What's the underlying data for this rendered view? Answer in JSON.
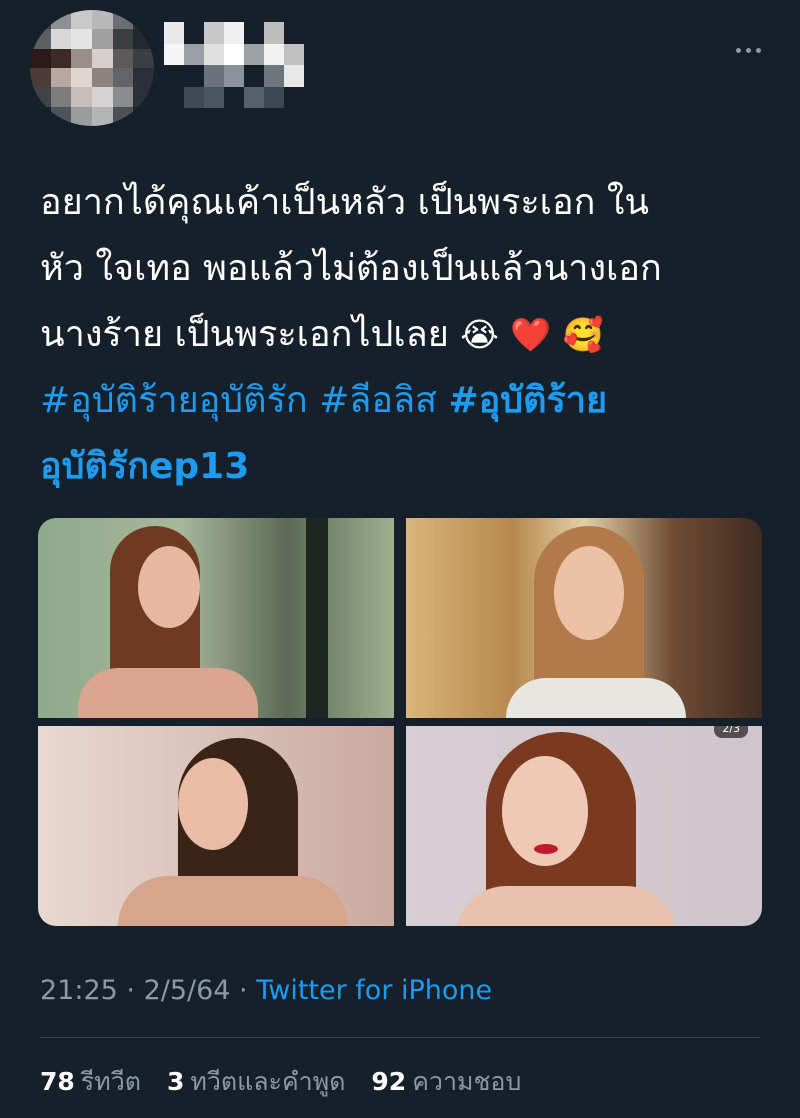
{
  "tweet": {
    "text_line_1": "อยากได้คุณเค้าเป็นหลัว เป็นพระเอก ใน",
    "text_line_2": "หัว ใจเทอ พอแล้วไม่ต้องเป็นแล้วนางเอก",
    "text_line_3": "นางร้าย เป็นพระเอกไปเลย",
    "emoji_1": "😭",
    "emoji_2": "❤️",
    "emoji_3": "🥰",
    "hashtag_1": "#อุบัติร้ายอุบัติรัก",
    "hashtag_2": "#ลีอลิส",
    "hashtag_3_part1": "#อุบัติร้าย",
    "hashtag_3_part2": "อุบัติรักep13"
  },
  "media": {
    "page_badge": "2/3"
  },
  "meta": {
    "time": "21:25",
    "separator_1": " · ",
    "date": "2/5/64",
    "separator_2": " · ",
    "source": "Twitter for iPhone"
  },
  "stats": {
    "retweets_count": "78",
    "retweets_label": "รีทวีต",
    "quotes_count": "3",
    "quotes_label": "ทวีตและคำพูด",
    "likes_count": "92",
    "likes_label": "ความชอบ"
  },
  "colors": {
    "background": "#15202b",
    "link": "#1d9bf0",
    "secondary_text": "#8b98a5",
    "divider": "#38444d"
  }
}
